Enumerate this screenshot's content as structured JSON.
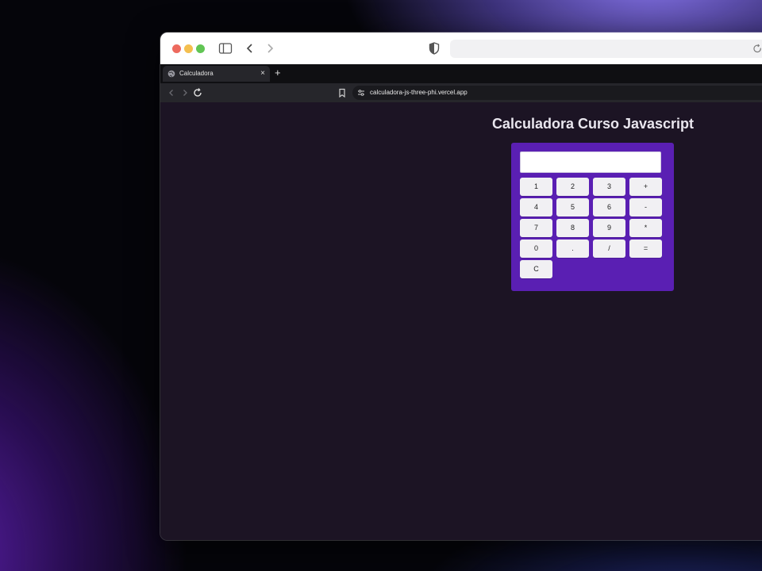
{
  "browser": {
    "tab_title": "Calculadora",
    "tab_close": "×",
    "new_tab": "+",
    "url": "calculadora-js-three-phi.vercel.app"
  },
  "page": {
    "title": "Calculadora Curso Javascript"
  },
  "calculator": {
    "display_value": "",
    "keys": [
      "1",
      "2",
      "3",
      "+",
      "4",
      "5",
      "6",
      "-",
      "7",
      "8",
      "9",
      "*",
      "0",
      ".",
      "/",
      "=",
      "C"
    ]
  },
  "colors": {
    "page_background": "#1c1424",
    "calculator_panel": "#5a1fb3",
    "key_background": "#f1f0f3"
  }
}
